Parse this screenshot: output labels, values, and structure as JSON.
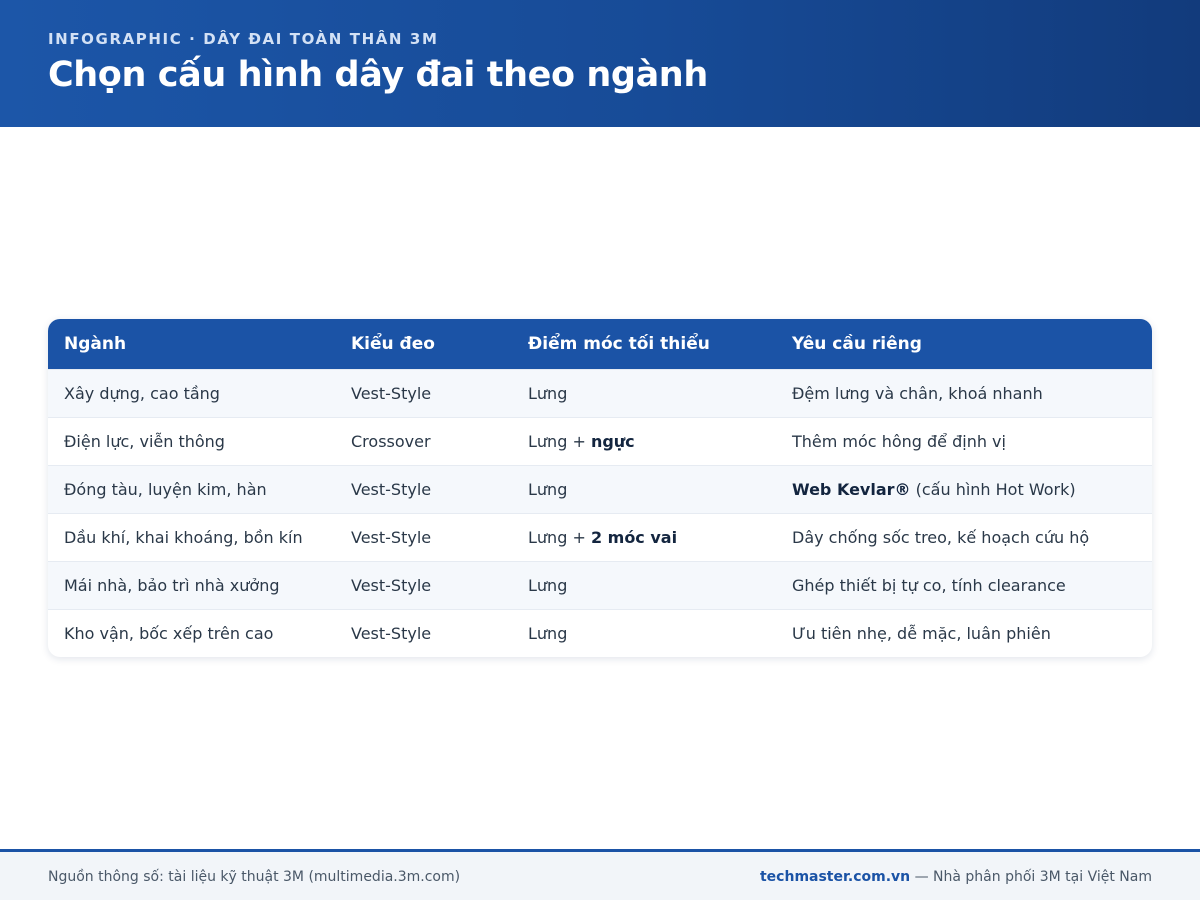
{
  "header": {
    "kicker": "INFOGRAPHIC · DÂY ĐAI TOÀN THÂN 3M",
    "title": "Chọn cấu hình dây đai theo ngành"
  },
  "table": {
    "columns": [
      "Ngành",
      "Kiểu đeo",
      "Điểm móc tối thiểu",
      "Yêu cầu riêng"
    ],
    "rows": [
      {
        "industry": "Xây dựng, cao tầng",
        "style": "Vest-Style",
        "anchor": {
          "base": "Lưng",
          "plus": ""
        },
        "req": {
          "bold": "",
          "text": "Đệm lưng và chân, khoá nhanh"
        }
      },
      {
        "industry": "Điện lực, viễn thông",
        "style": "Crossover",
        "anchor": {
          "base": "Lưng + ",
          "plus": "ngực"
        },
        "req": {
          "bold": "",
          "text": "Thêm móc hông để định vị"
        }
      },
      {
        "industry": "Đóng tàu, luyện kim, hàn",
        "style": "Vest-Style",
        "anchor": {
          "base": "Lưng",
          "plus": ""
        },
        "req": {
          "bold": "Web Kevlar®",
          "text": " (cấu hình Hot Work)"
        }
      },
      {
        "industry": "Dầu khí, khai khoáng, bồn kín",
        "style": "Vest-Style",
        "anchor": {
          "base": "Lưng + ",
          "plus": "2 móc vai"
        },
        "req": {
          "bold": "",
          "text": "Dây chống sốc treo, kế hoạch cứu hộ"
        }
      },
      {
        "industry": "Mái nhà, bảo trì nhà xưởng",
        "style": "Vest-Style",
        "anchor": {
          "base": "Lưng",
          "plus": ""
        },
        "req": {
          "bold": "",
          "text": "Ghép thiết bị tự co, tính clearance"
        }
      },
      {
        "industry": "Kho vận, bốc xếp trên cao",
        "style": "Vest-Style",
        "anchor": {
          "base": "Lưng",
          "plus": ""
        },
        "req": {
          "bold": "",
          "text": "Ưu tiên nhẹ, dễ mặc, luân phiên"
        }
      }
    ]
  },
  "footer": {
    "source": "Nguồn thông số: tài liệu kỹ thuật 3M (multimedia.3m.com)",
    "site": "techmaster.com.vn",
    "distributor": " — Nhà phân phối 3M tại Việt Nam"
  },
  "colors": {
    "header_bg": "#1c56a8",
    "table_head_bg": "#1b53a6",
    "alt_row_bg": "#f5f8fc",
    "footer_bg": "#f2f5f9"
  }
}
